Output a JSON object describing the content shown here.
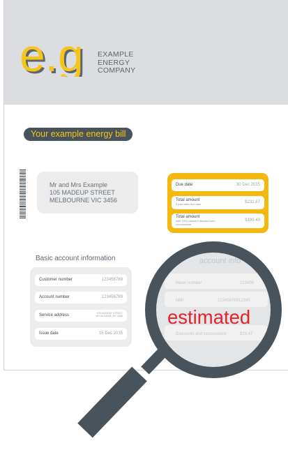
{
  "logo": {
    "mark": "e.g",
    "company_lines": [
      "EXAMPLE",
      "ENERGY",
      "COMPANY"
    ]
  },
  "bill_title": "Your example energy bill",
  "address": {
    "lines": [
      "Mr and Mrs Example",
      "105 MADEUP STREET",
      "MELBOURNE VIC 3456"
    ]
  },
  "payment": {
    "due_label": "Due date",
    "due_value": "30 Dec 2015",
    "total1_label": "Total amount",
    "total1_sub": "if paid after due date",
    "total1_value": "$232.87",
    "total2_label": "Total amount",
    "total2_sub": "with 15% payment discount and concessions",
    "total2_value": "$199.40"
  },
  "basic": {
    "title": "Basic account information",
    "rows": [
      {
        "label": "Customer number",
        "value": "123456789"
      },
      {
        "label": "Account number",
        "value": "123456789"
      },
      {
        "label": "Service address",
        "value_lines": [
          "105 MADEUP STREET",
          "MELBOURNE VIC 3456"
        ]
      },
      {
        "label": "Issue date",
        "value": "15 Dec 2015"
      }
    ]
  },
  "zoomed": {
    "title": "account info",
    "meter_label": "Meter number",
    "meter_value": "123456",
    "nmi_label": "NMI",
    "nmi_value": "12345678912345",
    "discounts_label": "Discounts and concessions",
    "discounts_value": "$33.47"
  },
  "stamp": "estimated",
  "colors": {
    "accent": "#f5b80f",
    "dark": "#48535c",
    "stamp": "#e3242b"
  }
}
